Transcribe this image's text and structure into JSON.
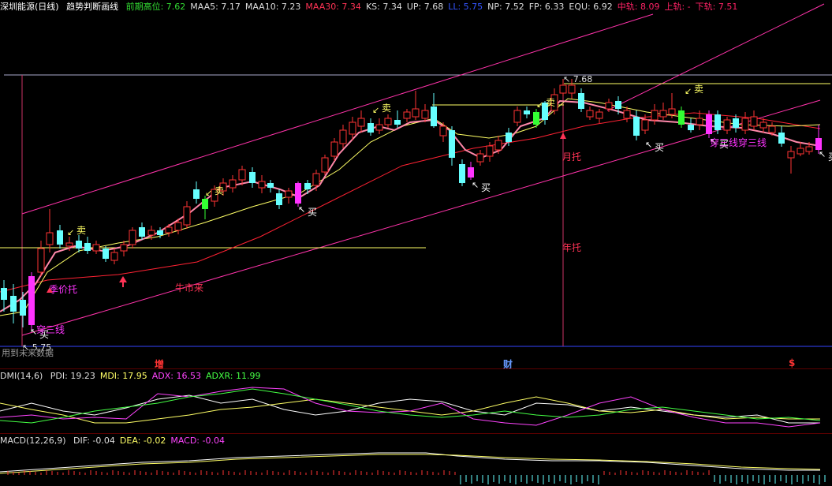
{
  "header": {
    "title": "深圳能源(日线)",
    "indicator": "趋势判断画线",
    "items": [
      {
        "label": "前期高位:",
        "value": "7.62",
        "color": "#33dd33"
      },
      {
        "label": "MAA5:",
        "value": "7.17",
        "color": "#dddddd"
      },
      {
        "label": "MAA10:",
        "value": "7.23",
        "color": "#dddddd"
      },
      {
        "label": "MAA30:",
        "value": "7.34",
        "color": "#ff3355"
      },
      {
        "label": "KS:",
        "value": "7.34",
        "color": "#dddddd"
      },
      {
        "label": "UP:",
        "value": "7.68",
        "color": "#dddddd"
      },
      {
        "label": "LL:",
        "value": "5.75",
        "color": "#3355ff"
      },
      {
        "label": "NP:",
        "value": "7.52",
        "color": "#dddddd"
      },
      {
        "label": "FP:",
        "value": "6.33",
        "color": "#dddddd"
      },
      {
        "label": "EQU:",
        "value": "6.92",
        "color": "#dddddd"
      },
      {
        "label": "中轨:",
        "value": "8.09",
        "color": "#ff2266"
      },
      {
        "label": "上轨:",
        "value": "-",
        "color": "#ff2266"
      },
      {
        "label": "下轨:",
        "value": "7.51",
        "color": "#ff2266"
      }
    ]
  },
  "dmi": {
    "title": "DMI(14,6)",
    "items": [
      {
        "label": "PDI:",
        "value": "19.23",
        "color": "#dddddd"
      },
      {
        "label": "MDI:",
        "value": "17.95",
        "color": "#ffff66"
      },
      {
        "label": "ADX:",
        "value": "16.53",
        "color": "#ff44ff"
      },
      {
        "label": "ADXR:",
        "value": "11.99",
        "color": "#44ff44"
      }
    ]
  },
  "macd": {
    "title": "MACD(12,26,9)",
    "items": [
      {
        "label": "DIF:",
        "value": "-0.04",
        "color": "#dddddd"
      },
      {
        "label": "DEA:",
        "value": "-0.02",
        "color": "#ffff66"
      },
      {
        "label": "MACD:",
        "value": "-0.04",
        "color": "#ff44ff"
      }
    ]
  },
  "annotations": {
    "high_price": "7.68",
    "low_price": "5.75",
    "sell": "卖",
    "buy": "买",
    "yue_tuo": "月托",
    "nian_tuo": "年托",
    "niu_shi": "牛市来",
    "ji_jia_tuo": "季价托",
    "chuan_san_xian": "穿三线",
    "future_note": "用到未来数据"
  },
  "bottom_marks": {
    "zeng": "增",
    "cai": "财",
    "dollar": "$"
  }
}
